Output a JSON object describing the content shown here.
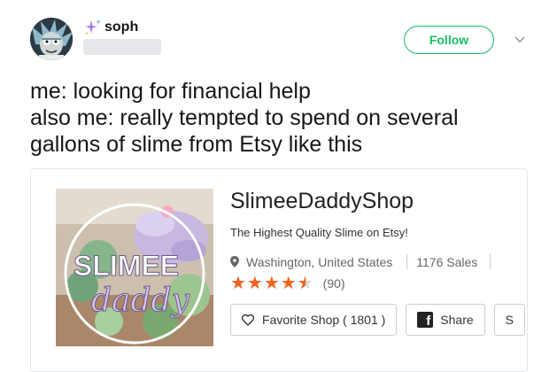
{
  "user": {
    "display_name": "soph",
    "avatar_icon": "cartoon-avatar-icon",
    "badge_icon": "sparkle-icon",
    "handle_hidden": true
  },
  "actions": {
    "follow_label": "Follow",
    "more_icon": "chevron-down-icon"
  },
  "tweet": {
    "lines": [
      "me: looking for financial help",
      "also me: really tempted to spend on several",
      "gallons of slime from Etsy like this"
    ]
  },
  "card": {
    "image_logo_text": [
      "SLIMEE",
      "daddy"
    ],
    "shop_name": "SlimeeDaddyShop",
    "tagline": "The Highest Quality Slime on Etsy!",
    "location": "Washington, United States",
    "sales": "1176 Sales",
    "rating": 4.5,
    "rating_max": 5,
    "review_count": "(90)",
    "favorite_label": "Favorite Shop ( 1801 )",
    "share_label": "Share",
    "third_button_partial": "S"
  },
  "colors": {
    "follow_green": "#17bf63",
    "star_orange": "#f1641e",
    "text_dark": "#14171a"
  }
}
